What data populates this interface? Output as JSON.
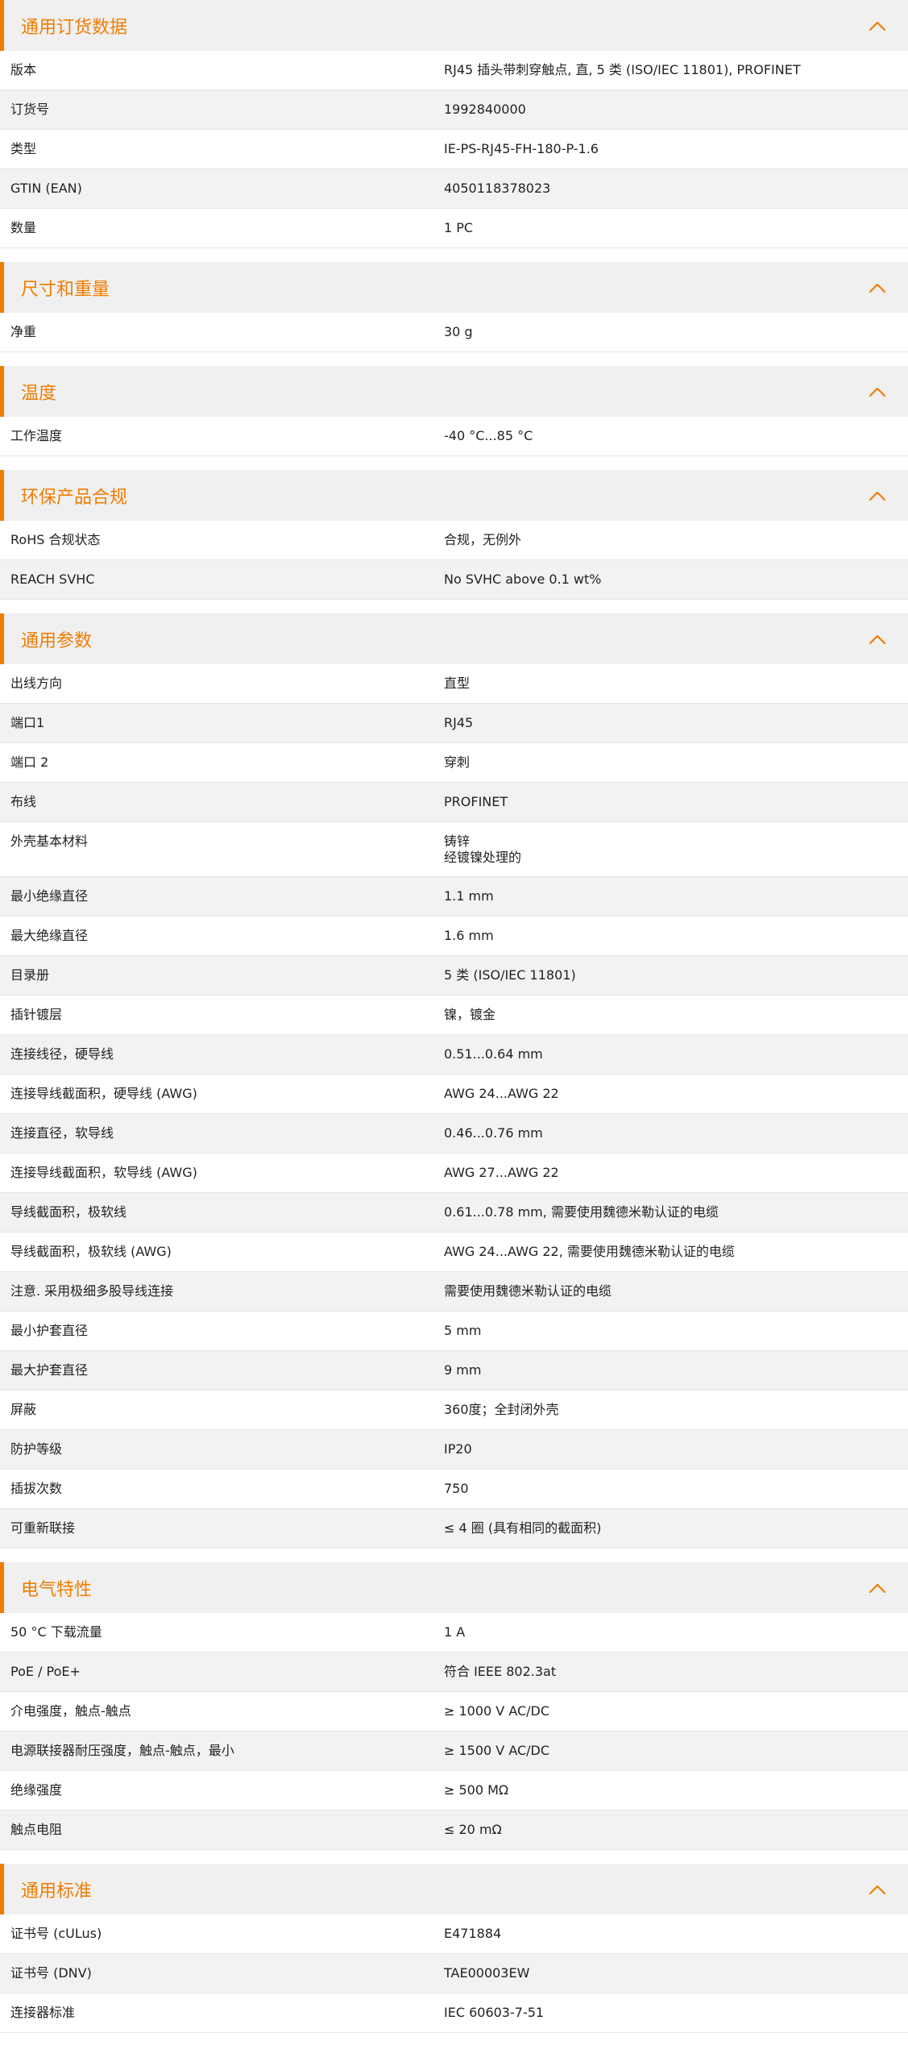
{
  "theme": {
    "accent": "#f07d00",
    "header_bg": "#f0f0f0",
    "stripe_bg": "#f2f2f2"
  },
  "sections": [
    {
      "title": "通用订货数据",
      "icon": "chevron-up-icon",
      "rows": [
        {
          "label": "版本",
          "value": "RJ45 插头带刺穿触点, 直, 5 类 (ISO/IEC 11801), PROFINET"
        },
        {
          "label": "订货号",
          "value": "1992840000"
        },
        {
          "label": "类型",
          "value": "IE-PS-RJ45-FH-180-P-1.6"
        },
        {
          "label": "GTIN (EAN)",
          "value": "4050118378023"
        },
        {
          "label": "数量",
          "value": "1  PC"
        }
      ]
    },
    {
      "title": "尺寸和重量",
      "icon": "chevron-up-icon",
      "rows": [
        {
          "label": "净重",
          "value": "30  g"
        }
      ]
    },
    {
      "title": "温度",
      "icon": "chevron-up-icon",
      "rows": [
        {
          "label": "工作温度",
          "value": "-40 °C...85 °C"
        }
      ]
    },
    {
      "title": "环保产品合规",
      "icon": "chevron-up-icon",
      "rows": [
        {
          "label": "RoHS 合规状态",
          "value": "合规，无例外"
        },
        {
          "label": "REACH SVHC",
          "value": "No SVHC above 0.1 wt%"
        }
      ]
    },
    {
      "title": "通用参数",
      "icon": "chevron-up-icon",
      "rows": [
        {
          "label": "出线方向",
          "value": "直型"
        },
        {
          "label": "端口1",
          "value": "RJ45"
        },
        {
          "label": "端口 2",
          "value": "穿刺"
        },
        {
          "label": "布线",
          "value": "PROFINET"
        },
        {
          "label": "外壳基本材料",
          "value": "铸锌",
          "value2": "经镀镍处理的"
        },
        {
          "label": "最小绝缘直径",
          "value": "1.1  mm"
        },
        {
          "label": "最大绝缘直径",
          "value": "1.6  mm"
        },
        {
          "label": "目录册",
          "value": "5 类 (ISO/IEC 11801)"
        },
        {
          "label": "插针镀层",
          "value": "镍，镀金"
        },
        {
          "label": "连接线径，硬导线",
          "value": "0.51...0.64 mm"
        },
        {
          "label": "连接导线截面积，硬导线 (AWG)",
          "value": "AWG 24...AWG 22"
        },
        {
          "label": "连接直径，软导线",
          "value": "0.46...0.76 mm"
        },
        {
          "label": "连接导线截面积，软导线 (AWG)",
          "value": "AWG 27...AWG 22"
        },
        {
          "label": "导线截面积，极软线",
          "value": "0.61...0.78 mm, 需要使用魏德米勒认证的电缆"
        },
        {
          "label": "导线截面积，极软线 (AWG)",
          "value": "AWG 24...AWG 22, 需要使用魏德米勒认证的电缆"
        },
        {
          "label": "注意. 采用极细多股导线连接",
          "value": "需要使用魏德米勒认证的电缆"
        },
        {
          "label": "最小护套直径",
          "value": "5  mm"
        },
        {
          "label": "最大护套直径",
          "value": "9  mm"
        },
        {
          "label": "屏蔽",
          "value": "360度；全封闭外壳"
        },
        {
          "label": "防护等级",
          "value": "IP20"
        },
        {
          "label": "插拔次数",
          "value": "750"
        },
        {
          "label": "可重新联接",
          "value": "≤ 4 圈 (具有相同的截面积)"
        }
      ]
    },
    {
      "title": "电气特性",
      "icon": "chevron-up-icon",
      "rows": [
        {
          "label": "50 °C 下载流量",
          "value": "1  A"
        },
        {
          "label": "PoE / PoE+",
          "value": "符合 IEEE 802.3at"
        },
        {
          "label": "介电强度，触点-触点",
          "value": "≥ 1000 V AC/DC"
        },
        {
          "label": "电源联接器耐压强度，触点-触点，最小",
          "value": "≥ 1500 V AC/DC"
        },
        {
          "label": "绝缘强度",
          "value": "≥ 500 MΩ"
        },
        {
          "label": "触点电阻",
          "value": "≤ 20 mΩ"
        }
      ]
    },
    {
      "title": "通用标准",
      "icon": "chevron-up-icon",
      "rows": [
        {
          "label": "证书号 (cULus)",
          "value": "E471884"
        },
        {
          "label": "证书号 (DNV)",
          "value": "TAE00003EW"
        },
        {
          "label": "连接器标准",
          "value": "IEC 60603-7-51"
        }
      ]
    }
  ]
}
